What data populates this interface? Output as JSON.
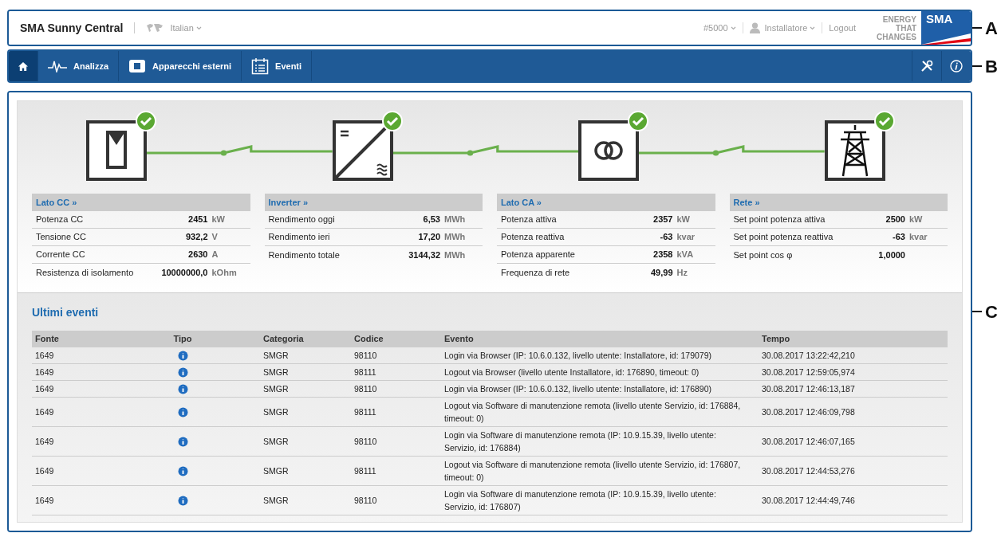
{
  "header": {
    "brand": "SMA Sunny Central",
    "language": "Italian",
    "device": "#5000",
    "user": "Installatore",
    "logout": "Logout",
    "tagline": [
      "ENERGY",
      "THAT",
      "CHANGES"
    ],
    "logo": "SMA"
  },
  "nav": {
    "items": [
      {
        "kind": "home",
        "selected": true
      },
      {
        "kind": "analysis",
        "label": "Analizza",
        "selected": false
      },
      {
        "kind": "device",
        "label": "Apparecchi esterni",
        "selected": false
      },
      {
        "kind": "events",
        "label": "Eventi",
        "selected": false
      }
    ],
    "tools": [
      {
        "kind": "settings"
      },
      {
        "kind": "info"
      }
    ]
  },
  "diagram": {
    "nodes": [
      {
        "kind": "pv",
        "ok": true
      },
      {
        "kind": "inverter",
        "ok": true
      },
      {
        "kind": "transformer",
        "ok": true
      },
      {
        "kind": "grid",
        "ok": true
      }
    ]
  },
  "panels": [
    {
      "title": "Lato CC »",
      "rows": [
        {
          "label": "Potenza CC",
          "value": "2451",
          "unit": "kW"
        },
        {
          "label": "Tensione CC",
          "value": "932,2",
          "unit": "V"
        },
        {
          "label": "Corrente CC",
          "value": "2630",
          "unit": "A"
        },
        {
          "label": "Resistenza di isolamento",
          "value": "10000000,0",
          "unit": "kOhm"
        }
      ]
    },
    {
      "title": "Inverter »",
      "rows": [
        {
          "label": "Rendimento oggi",
          "value": "6,53",
          "unit": "MWh"
        },
        {
          "label": "Rendimento ieri",
          "value": "17,20",
          "unit": "MWh"
        },
        {
          "label": "Rendimento totale",
          "value": "3144,32",
          "unit": "MWh"
        }
      ]
    },
    {
      "title": "Lato CA »",
      "rows": [
        {
          "label": "Potenza attiva",
          "value": "2357",
          "unit": "kW"
        },
        {
          "label": "Potenza reattiva",
          "value": "-63",
          "unit": "kvar"
        },
        {
          "label": "Potenza apparente",
          "value": "2358",
          "unit": "kVA"
        },
        {
          "label": "Frequenza di rete",
          "value": "49,99",
          "unit": "Hz"
        }
      ]
    },
    {
      "title": "Rete »",
      "rows": [
        {
          "label": "Set point potenza attiva",
          "value": "2500",
          "unit": "kW"
        },
        {
          "label": "Set point potenza reattiva",
          "value": "-63",
          "unit": "kvar"
        },
        {
          "label": "Set point cos φ",
          "value": "1,0000"
        }
      ]
    }
  ],
  "events": {
    "title": "Ultimi eventi",
    "columns": [
      "Fonte",
      "Tipo",
      "Categoria",
      "Codice",
      "Evento",
      "Tempo"
    ],
    "rows": [
      {
        "source": "1649",
        "kind": "info",
        "category": "SMGR",
        "code": "98110",
        "event": "Login via Browser (IP: 10.6.0.132, livello utente: Installatore, id: 179079)",
        "time": "30.08.2017 13:22:42,210"
      },
      {
        "source": "1649",
        "kind": "info",
        "category": "SMGR",
        "code": "98111",
        "event": "Logout via Browser (livello utente Installatore, id: 176890, timeout: 0)",
        "time": "30.08.2017 12:59:05,974"
      },
      {
        "source": "1649",
        "kind": "info",
        "category": "SMGR",
        "code": "98110",
        "event": "Login via Browser (IP: 10.6.0.132, livello utente: Installatore, id: 176890)",
        "time": "30.08.2017 12:46:13,187"
      },
      {
        "source": "1649",
        "kind": "info",
        "category": "SMGR",
        "code": "98111",
        "event": "Logout via Software di manutenzione remota (livello utente Servizio, id: 176884, timeout: 0)",
        "time": "30.08.2017 12:46:09,798"
      },
      {
        "source": "1649",
        "kind": "info",
        "category": "SMGR",
        "code": "98110",
        "event": "Login via Software di manutenzione remota (IP: 10.9.15.39, livello utente: Servizio, id: 176884)",
        "time": "30.08.2017 12:46:07,165"
      },
      {
        "source": "1649",
        "kind": "info",
        "category": "SMGR",
        "code": "98111",
        "event": "Logout via Software di manutenzione remota (livello utente Servizio, id: 176807, timeout: 0)",
        "time": "30.08.2017 12:44:53,276"
      },
      {
        "source": "1649",
        "kind": "info",
        "category": "SMGR",
        "code": "98110",
        "event": "Login via Software di manutenzione remota (IP: 10.9.15.39, livello utente: Servizio, id: 176807)",
        "time": "30.08.2017 12:44:49,746"
      }
    ]
  },
  "callouts": [
    "A",
    "B",
    "C"
  ]
}
